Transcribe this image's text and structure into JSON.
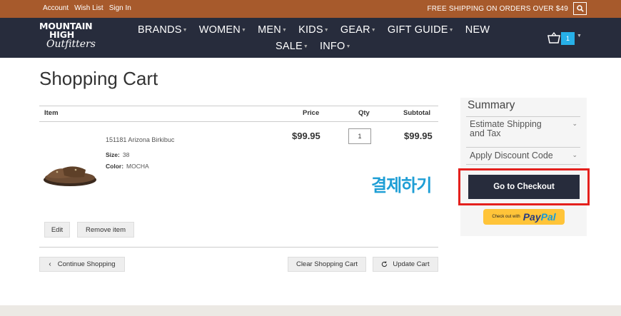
{
  "topbar": {
    "links": [
      "Account",
      "Wish List",
      "Sign In"
    ],
    "shipping_text": "FREE SHIPPING ON ORDERS OVER $49",
    "search_icon": "search-icon"
  },
  "brand": {
    "line1": "MOUNTAIN",
    "line2": "HIGH",
    "line3": "Outfitters"
  },
  "nav": {
    "row1": [
      "BRANDS",
      "WOMEN",
      "MEN",
      "KIDS",
      "GEAR",
      "GIFT GUIDE",
      "NEW"
    ],
    "row2": [
      "SALE",
      "INFO"
    ],
    "cart_count": "1"
  },
  "page": {
    "title": "Shopping Cart"
  },
  "cart_table": {
    "headers": {
      "item": "Item",
      "price": "Price",
      "qty": "Qty",
      "subtotal": "Subtotal"
    },
    "items": [
      {
        "name": "151181 Arizona Birkibuc",
        "size_label": "Size:",
        "size_value": "38",
        "color_label": "Color:",
        "color_value": "MOCHA",
        "price": "$99.95",
        "qty": "1",
        "subtotal": "$99.95"
      }
    ]
  },
  "item_actions": {
    "edit": "Edit",
    "remove": "Remove item"
  },
  "cart_actions": {
    "continue": "Continue Shopping",
    "clear": "Clear Shopping Cart",
    "update": "Update Cart"
  },
  "summary": {
    "title": "Summary",
    "estimate_line1": "Estimate Shipping",
    "estimate_line2": "and Tax",
    "discount": "Apply Discount Code",
    "checkout": "Go to Checkout",
    "paypal_small": "Check out with",
    "paypal_pay": "Pay",
    "paypal_pal": "Pal"
  },
  "annotation": {
    "text": "결제하기",
    "color": "#1e9ed5",
    "highlight_color": "#e4201d"
  },
  "colors": {
    "topbar": "#a75a2c",
    "nav": "#272c3c",
    "badge": "#27b0e8",
    "paypal": "#ffc439"
  }
}
